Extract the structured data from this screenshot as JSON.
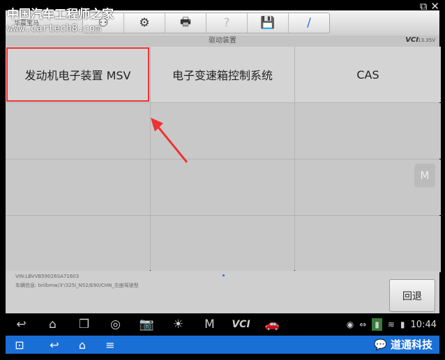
{
  "watermark": {
    "site_name": "中国汽车工程师之家",
    "url": "www.cartech8.com",
    "brand": "华晨宝马"
  },
  "window_icons": {
    "external": "external-link-icon",
    "close": "✕"
  },
  "toolbar": {
    "icons": [
      "home-icon",
      "vehicle-icon",
      "gear-icon",
      "printer-icon",
      "help-icon",
      "save-icon",
      "pen-icon"
    ]
  },
  "titlebar": {
    "title": "驱动装置",
    "vci": "VCI",
    "voltage": "13.35V"
  },
  "grid": {
    "items": [
      "发动机电子装置 MSV",
      "电子变速箱控制系统",
      "CAS",
      "",
      "",
      "",
      "",
      "",
      "",
      "",
      "",
      ""
    ],
    "selected_index": 0
  },
  "info": {
    "vin": "VIN:LBVVB59026SA71603",
    "vehicle": "车辆信息: brilbmw/3'/325i_N52/E90/CHN_左座驾驶型",
    "back_label": "回退"
  },
  "status": {
    "time": "10:44"
  },
  "footer": {
    "wechat_label": "道通科技"
  },
  "colors": {
    "selection": "#e33333",
    "nav_blue": "#1a6fd6"
  }
}
